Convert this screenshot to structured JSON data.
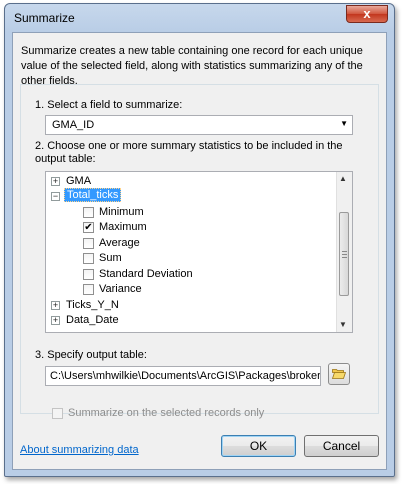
{
  "window": {
    "title": "Summarize",
    "close_label": "x"
  },
  "description": "Summarize creates a new table containing one record for each unique value of the selected field, along with statistics summarizing any of the other fields.",
  "step1": {
    "label": "1.  Select a field to summarize:",
    "value": "GMA_ID"
  },
  "step2": {
    "label": "2.  Choose one or more summary statistics to be included in the output table:",
    "tree": {
      "gma": {
        "label": "GMA",
        "expander": "+"
      },
      "total_ticks": {
        "label": "Total_ticks",
        "expander": "−",
        "selected": true
      },
      "stats": [
        {
          "label": "Minimum",
          "checked": false
        },
        {
          "label": "Maximum",
          "checked": true
        },
        {
          "label": "Average",
          "checked": false
        },
        {
          "label": "Sum",
          "checked": false
        },
        {
          "label": "Standard Deviation",
          "checked": false
        },
        {
          "label": "Variance",
          "checked": false
        }
      ],
      "ticks_yn": {
        "label": "Ticks_Y_N",
        "expander": "+"
      },
      "data_date": {
        "label": "Data_Date",
        "expander": "+"
      }
    }
  },
  "step3": {
    "label": "3.  Specify output table:",
    "value": "C:\\Users\\mhwilkie\\Documents\\ArcGIS\\Packages\\broker"
  },
  "selected_only": {
    "label": "Summarize on the selected records only",
    "checked": false,
    "enabled": false
  },
  "help_link": "About summarizing data",
  "buttons": {
    "ok": "OK",
    "cancel": "Cancel"
  },
  "colors": {
    "selection": "#3399ff",
    "link": "#0066cc",
    "frame": "#b9cde6",
    "close": "#c2361e"
  }
}
